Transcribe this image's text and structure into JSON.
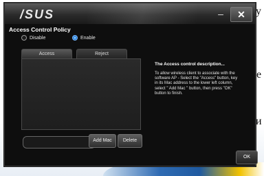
{
  "window": {
    "logo_text": "/SUS",
    "minimize_label": "–",
    "close_label": "✕"
  },
  "background_text": {
    "top": "у",
    "mid": "е",
    "low": "и"
  },
  "policy": {
    "heading": "Access Control Policy",
    "options": [
      {
        "label": "Disable",
        "selected": false
      },
      {
        "label": "Enable",
        "selected": true
      }
    ]
  },
  "tabs": [
    {
      "label": "Access",
      "active": true
    },
    {
      "label": "Reject",
      "active": false
    }
  ],
  "mac_input": {
    "value": "",
    "placeholder": ""
  },
  "buttons": {
    "add_mac": "Add Mac",
    "delete": "Delete",
    "ok": "OK"
  },
  "description": {
    "title": "The Access control description...",
    "body": "To allow wireless client to associate with the software AP - Select the \"Access\" button, key in its Mac address to the lower left column, select \" Add Mac \" button, then press \"OK\" button to finish."
  },
  "colors": {
    "window_bg": "#0e0e0e",
    "accent_radio": "#2a7bd0"
  }
}
